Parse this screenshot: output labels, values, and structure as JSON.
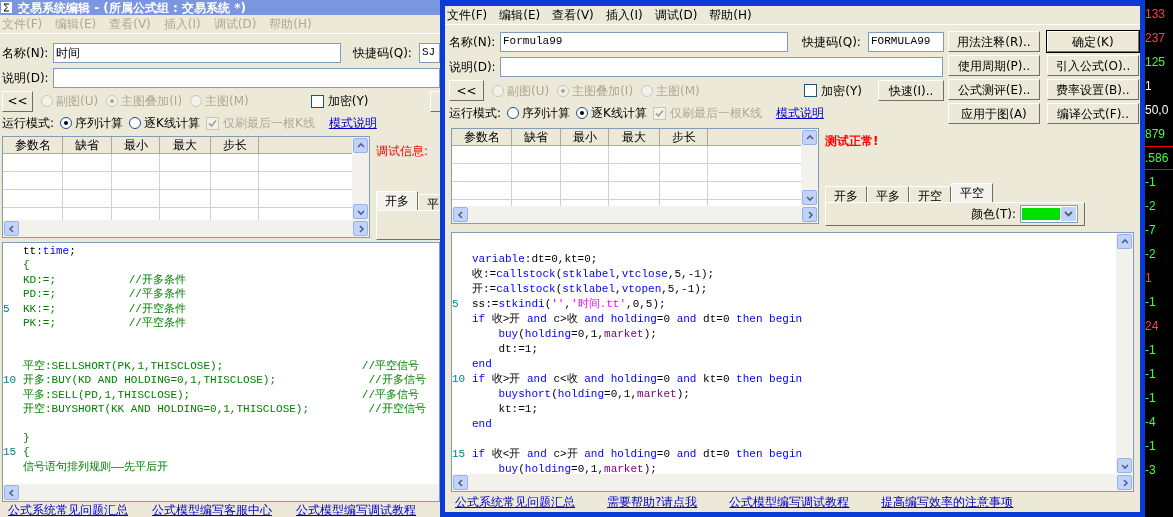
{
  "back_window": {
    "active": false,
    "title": "交易系统编辑 - (所属公式组 : 交易系统 *)",
    "menu": [
      "文件(F)",
      "编辑(E)",
      "查看(V)",
      "插入(I)",
      "调试(D)",
      "帮助(H)"
    ],
    "name": {
      "label": "名称(N):",
      "value": "时间"
    },
    "shortcut": {
      "label": "快捷码(Q):",
      "value": "SJ"
    },
    "description": {
      "label": "说明(D):"
    },
    "collapse_button": "<<",
    "chart_types": [
      {
        "label": "副图(U)",
        "selected": false,
        "disabled": true
      },
      {
        "label": "主图叠加(I)",
        "selected": true,
        "disabled": true
      },
      {
        "label": "主图(M)",
        "selected": false,
        "disabled": true
      }
    ],
    "encrypt": {
      "label": "加密(Y)",
      "checked": false
    },
    "run_mode": {
      "label": "运行模式:",
      "options": [
        {
          "label": "序列计算",
          "selected": true
        },
        {
          "label": "逐K线计算",
          "selected": false
        }
      ]
    },
    "refresh_last_bar": {
      "label": "仅刷最后一根K线",
      "checked": true,
      "disabled": true
    },
    "mode_link": "模式说明",
    "param_table": {
      "columns": [
        "参数名",
        "缺省",
        "最小",
        "最大",
        "步长"
      ]
    },
    "debug_label": "调试信息:",
    "signal_tabs": [
      {
        "label": "开多",
        "selected": true
      },
      {
        "label": "平",
        "selected": false
      }
    ],
    "editor": {
      "lines": [
        {
          "kind": "code",
          "segments": [
            {
              "text": "tt:",
              "kind": "plain"
            },
            {
              "text": "time",
              "kind": "identifier"
            },
            {
              "text": ";",
              "kind": "plain"
            }
          ]
        },
        {
          "kind": "code",
          "segments": [
            {
              "text": "{",
              "kind": "statement"
            }
          ]
        },
        {
          "kind": "code",
          "segments": [
            {
              "text": "KD:=;           ",
              "kind": "statement"
            },
            {
              "text": "//开多条件",
              "kind": "comment"
            }
          ]
        },
        {
          "kind": "code",
          "segments": [
            {
              "text": "PD:=;           ",
              "kind": "statement"
            },
            {
              "text": "//平多条件",
              "kind": "comment"
            }
          ]
        },
        {
          "kind": "code",
          "number": "5",
          "segments": [
            {
              "text": "KK:=;           ",
              "kind": "statement"
            },
            {
              "text": "//开空条件",
              "kind": "comment"
            }
          ]
        },
        {
          "kind": "code",
          "segments": [
            {
              "text": "PK:=;           ",
              "kind": "statement"
            },
            {
              "text": "//平空条件",
              "kind": "comment"
            }
          ]
        },
        {
          "kind": "blank"
        },
        {
          "kind": "blank"
        },
        {
          "kind": "code",
          "segments": [
            {
              "text": "平空:SELLSHORT(PK,1,THISCLOSE);                     ",
              "kind": "statement"
            },
            {
              "text": "//平空信号",
              "kind": "comment"
            }
          ]
        },
        {
          "kind": "code",
          "number": "10",
          "segments": [
            {
              "text": "开多:BUY(KD AND HOLDING=0,1,THISCLOSE);              ",
              "kind": "statement"
            },
            {
              "text": "//开多信号",
              "kind": "comment"
            }
          ]
        },
        {
          "kind": "code",
          "segments": [
            {
              "text": "平多:SELL(PD,1,THISCLOSE);                          ",
              "kind": "statement"
            },
            {
              "text": "//平多信号",
              "kind": "comment"
            }
          ]
        },
        {
          "kind": "code",
          "segments": [
            {
              "text": "开空:BUYSHORT(KK AND HOLDING=0,1,THISCLOSE);         ",
              "kind": "statement"
            },
            {
              "text": "//开空信号",
              "kind": "comment"
            }
          ]
        },
        {
          "kind": "blank"
        },
        {
          "kind": "code",
          "segments": [
            {
              "text": "}",
              "kind": "statement"
            }
          ]
        },
        {
          "kind": "code",
          "number": "15",
          "segments": [
            {
              "text": "{",
              "kind": "statement"
            }
          ]
        },
        {
          "kind": "code",
          "segments": [
            {
              "text": "信号语句排列规则——先平后开",
              "kind": "statement"
            }
          ]
        }
      ]
    },
    "links": [
      "公式系统常见问题汇总",
      "公式模型编写客服中心",
      "公式模型编写调试教程"
    ]
  },
  "front_window": {
    "active": true,
    "menu": [
      "文件(F)",
      "编辑(E)",
      "查看(V)",
      "插入(I)",
      "调试(D)",
      "帮助(H)"
    ],
    "name": {
      "label": "名称(N):",
      "value": "Formula99"
    },
    "shortcut": {
      "label": "快捷码(Q):",
      "value": "FORMULA99"
    },
    "description": {
      "label": "说明(D):"
    },
    "collapse_button": "<<",
    "chart_types": [
      {
        "label": "副图(U)",
        "selected": false,
        "disabled": true
      },
      {
        "label": "主图叠加(I)",
        "selected": true,
        "disabled": true
      },
      {
        "label": "主图(M)",
        "selected": false,
        "disabled": true
      }
    ],
    "encrypt": {
      "label": "加密(Y)",
      "checked": false
    },
    "quick_button": "快速(I)..",
    "run_mode": {
      "label": "运行模式:",
      "options": [
        {
          "label": "序列计算",
          "selected": false
        },
        {
          "label": "逐K线计算",
          "selected": true
        }
      ]
    },
    "refresh_last_bar": {
      "label": "仅刷最后一根K线",
      "checked": true,
      "disabled": true
    },
    "mode_link": "模式说明",
    "buttons": [
      {
        "label": "用法注释(R)..",
        "default": false
      },
      {
        "label": "确定(K)",
        "default": true
      },
      {
        "label": "使用周期(P)..",
        "default": false
      },
      {
        "label": "引入公式(O)..",
        "default": false
      },
      {
        "label": "公式测评(E)..",
        "default": false
      },
      {
        "label": "费率设置(B)..",
        "default": false
      },
      {
        "label": "应用于图(A)",
        "default": false
      },
      {
        "label": "编译公式(F)..",
        "default": false
      }
    ],
    "param_table": {
      "columns": [
        "参数名",
        "缺省",
        "最小",
        "最大",
        "步长"
      ]
    },
    "test_status": "测试正常!",
    "signal_tabs": [
      {
        "label": "开多",
        "selected": false
      },
      {
        "label": "平多",
        "selected": false
      },
      {
        "label": "开空",
        "selected": false
      },
      {
        "label": "平空",
        "selected": true
      }
    ],
    "color_picker": {
      "label": "颜色(T):",
      "color": "#00e000"
    },
    "editor": {
      "lines": [
        {
          "kind": "blank"
        },
        {
          "kind": "code",
          "segments": [
            {
              "text": "variable",
              "kind": "keyword"
            },
            {
              "text": ":dt=0,kt=0;",
              "kind": "plain"
            }
          ]
        },
        {
          "kind": "code",
          "segments": [
            {
              "text": "收:=",
              "kind": "plain"
            },
            {
              "text": "callstock",
              "kind": "identifier"
            },
            {
              "text": "(",
              "kind": "plain"
            },
            {
              "text": "stklabel",
              "kind": "identifier"
            },
            {
              "text": ",",
              "kind": "plain"
            },
            {
              "text": "vtclose",
              "kind": "identifier"
            },
            {
              "text": ",5,-1);",
              "kind": "plain"
            }
          ]
        },
        {
          "kind": "code",
          "segments": [
            {
              "text": "开:=",
              "kind": "plain"
            },
            {
              "text": "callstock",
              "kind": "identifier"
            },
            {
              "text": "(",
              "kind": "plain"
            },
            {
              "text": "stklabel",
              "kind": "identifier"
            },
            {
              "text": ",",
              "kind": "plain"
            },
            {
              "text": "vtopen",
              "kind": "identifier"
            },
            {
              "text": ",5,-1);",
              "kind": "plain"
            }
          ]
        },
        {
          "kind": "code",
          "number": "5",
          "segments": [
            {
              "text": "ss:=",
              "kind": "plain"
            },
            {
              "text": "stkindi",
              "kind": "identifier"
            },
            {
              "text": "(",
              "kind": "plain"
            },
            {
              "text": "''",
              "kind": "string"
            },
            {
              "text": ",",
              "kind": "plain"
            },
            {
              "text": "'时间.tt'",
              "kind": "string"
            },
            {
              "text": ",0,5);",
              "kind": "plain"
            }
          ]
        },
        {
          "kind": "code",
          "segments": [
            {
              "text": "if",
              "kind": "keyword"
            },
            {
              "text": " 收>开 ",
              "kind": "plain"
            },
            {
              "text": "and",
              "kind": "keyword"
            },
            {
              "text": " c>收 ",
              "kind": "plain"
            },
            {
              "text": "and holding",
              "kind": "keyword"
            },
            {
              "text": "=0 ",
              "kind": "plain"
            },
            {
              "text": "and",
              "kind": "keyword"
            },
            {
              "text": " dt=0 ",
              "kind": "plain"
            },
            {
              "text": "then begin",
              "kind": "keyword"
            }
          ]
        },
        {
          "kind": "code",
          "segments": [
            {
              "text": "    buy",
              "kind": "identifier"
            },
            {
              "text": "(",
              "kind": "plain"
            },
            {
              "text": "holding",
              "kind": "identifier"
            },
            {
              "text": "=0,1,",
              "kind": "plain"
            },
            {
              "text": "market",
              "kind": "parameter"
            },
            {
              "text": ");",
              "kind": "plain"
            }
          ]
        },
        {
          "kind": "code",
          "segments": [
            {
              "text": "    dt:=1;",
              "kind": "plain"
            }
          ]
        },
        {
          "kind": "code",
          "segments": [
            {
              "text": "end",
              "kind": "keyword"
            }
          ]
        },
        {
          "kind": "code",
          "number": "10",
          "segments": [
            {
              "text": "if",
              "kind": "keyword"
            },
            {
              "text": " 收>开 ",
              "kind": "plain"
            },
            {
              "text": "and",
              "kind": "keyword"
            },
            {
              "text": " c<收 ",
              "kind": "plain"
            },
            {
              "text": "and holding",
              "kind": "keyword"
            },
            {
              "text": "=0 ",
              "kind": "plain"
            },
            {
              "text": "and",
              "kind": "keyword"
            },
            {
              "text": " kt=0 ",
              "kind": "plain"
            },
            {
              "text": "then begin",
              "kind": "keyword"
            }
          ]
        },
        {
          "kind": "code",
          "segments": [
            {
              "text": "    buyshort",
              "kind": "identifier"
            },
            {
              "text": "(",
              "kind": "plain"
            },
            {
              "text": "holding",
              "kind": "identifier"
            },
            {
              "text": "=0,1,",
              "kind": "plain"
            },
            {
              "text": "market",
              "kind": "parameter"
            },
            {
              "text": ");",
              "kind": "plain"
            }
          ]
        },
        {
          "kind": "code",
          "segments": [
            {
              "text": "    kt:=1;",
              "kind": "plain"
            }
          ]
        },
        {
          "kind": "code",
          "segments": [
            {
              "text": "end",
              "kind": "keyword"
            }
          ]
        },
        {
          "kind": "blank"
        },
        {
          "kind": "code",
          "number": "15",
          "segments": [
            {
              "text": "if",
              "kind": "keyword"
            },
            {
              "text": " 收<开 ",
              "kind": "plain"
            },
            {
              "text": "and",
              "kind": "keyword"
            },
            {
              "text": " c>开 ",
              "kind": "plain"
            },
            {
              "text": "and holding",
              "kind": "keyword"
            },
            {
              "text": "=0 ",
              "kind": "plain"
            },
            {
              "text": "and",
              "kind": "keyword"
            },
            {
              "text": " dt=0 ",
              "kind": "plain"
            },
            {
              "text": "then begin",
              "kind": "keyword"
            }
          ]
        },
        {
          "kind": "code",
          "segments": [
            {
              "text": "    buy",
              "kind": "identifier"
            },
            {
              "text": "(",
              "kind": "plain"
            },
            {
              "text": "holding",
              "kind": "identifier"
            },
            {
              "text": "=0,1,",
              "kind": "plain"
            },
            {
              "text": "market",
              "kind": "parameter"
            },
            {
              "text": ");",
              "kind": "plain"
            }
          ]
        }
      ]
    },
    "links": [
      "公式系统常见问题汇总",
      "需要帮助?请点我",
      "公式模型编写调试教程",
      "提高编写效率的注意事项"
    ]
  },
  "quote_strip": {
    "values": [
      {
        "text": "133",
        "color": "#ff4040",
        "selected": false
      },
      {
        "text": "237",
        "color": "#ff4040",
        "selected": false
      },
      {
        "text": "125",
        "color": "#40ff40",
        "selected": false
      },
      {
        "text": "1",
        "color": "#ffffff",
        "selected": false
      },
      {
        "text": "50,0",
        "color": "#ffffff",
        "selected": false
      },
      {
        "text": "879",
        "color": "#40ff40",
        "selected": false
      },
      {
        "text": ".586",
        "color": "#40ff40",
        "selected": true
      },
      {
        "text": "-1",
        "color": "#40ff40",
        "selected": false
      },
      {
        "text": "-2",
        "color": "#40ff40",
        "selected": false
      },
      {
        "text": "-7",
        "color": "#40ff40",
        "selected": false
      },
      {
        "text": "-2",
        "color": "#40ff40",
        "selected": false
      },
      {
        "text": "1",
        "color": "#ff4040",
        "selected": false
      },
      {
        "text": "-1",
        "color": "#40ff40",
        "selected": false
      },
      {
        "text": "24",
        "color": "#ff4040",
        "selected": false
      },
      {
        "text": "-1",
        "color": "#40ff40",
        "selected": false
      },
      {
        "text": "-1",
        "color": "#40ff40",
        "selected": false
      },
      {
        "text": "-1",
        "color": "#40ff40",
        "selected": false
      },
      {
        "text": "-4",
        "color": "#40ff40",
        "selected": false
      },
      {
        "text": "-1",
        "color": "#40ff40",
        "selected": false
      },
      {
        "text": "-3",
        "color": "#40ff40",
        "selected": false
      }
    ]
  }
}
